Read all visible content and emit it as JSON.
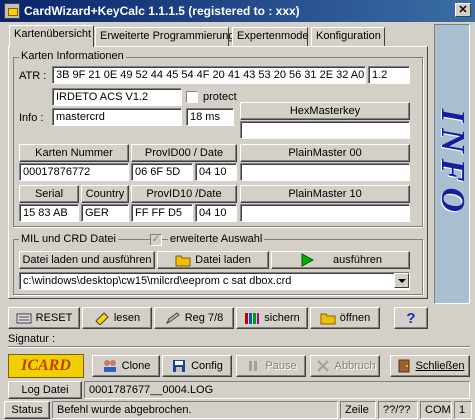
{
  "window": {
    "title": "CardWizard+KeyCalc 1.1.1.5 (registered to : xxx)",
    "close_glyph": "✕"
  },
  "tabs": [
    {
      "label": "Kartenübersicht",
      "active": true
    },
    {
      "label": "Erweiterte Programmierung"
    },
    {
      "label": "Expertenmode"
    },
    {
      "label": "Konfiguration"
    }
  ],
  "karten": {
    "legend": "Karten Informationen",
    "atr_label": "ATR :",
    "atr_value": "3B 9F 21 0E 49 52 44 45 54 4F 20 41 43 53 20 56 31 2E 32 A0",
    "atr_version": "1.2",
    "card_name": "IRDETO ACS V1.2",
    "protect_label": "protect",
    "info_label": "Info :",
    "info_value": "mastercrd",
    "info_time": "18 ms",
    "hexmasterkey_button": "HexMasterkey",
    "hexmasterkey_value": "",
    "kartennummer_button": "Karten Nummer",
    "kartennummer_value": "00017876772",
    "provid00_button": "ProvID00 / Date",
    "provid00_value": "06 6F 5D",
    "provid00_date": "04 10",
    "plainmaster00_button": "PlainMaster 00",
    "plainmaster00_value": "",
    "serial_button": "Serial",
    "serial_value": "15 83 AB",
    "country_button": "Country",
    "country_value": "GER",
    "provid10_button": "ProvID10 /Date",
    "provid10_value": "FF FF D5",
    "provid10_date": "04 10",
    "plainmaster10_button": "PlainMaster 10",
    "plainmaster10_value": ""
  },
  "mil": {
    "legend": "MIL und CRD Datei",
    "erweiterte_label": "erweiterte Auswahl",
    "checkmark": "✓",
    "load_execute_button": "Datei laden und ausführen",
    "load_button": "Datei laden",
    "execute_button": "ausführen",
    "file_path": "c:\\windows\\desktop\\cw15\\milcrd\\eeprom c sat dbox.crd"
  },
  "info_panel": {
    "text": "INFO"
  },
  "toolbar": {
    "reset": "RESET",
    "lesen": "lesen",
    "reg": "Reg 7/8",
    "sichern": "sichern",
    "oeffnen": "öffnen",
    "help": "?"
  },
  "signatur": {
    "label": "Signatur :",
    "value": ""
  },
  "actions": {
    "logo": "ICARD",
    "clone": "Clone",
    "config": "Config",
    "pause": "Pause",
    "abbruch": "Abbruch",
    "schliessen": "Schließen"
  },
  "logfile": {
    "label": "Log Datei",
    "value": "0001787677__0004.LOG"
  },
  "statusbar": {
    "label": "Status",
    "message": "Befehl wurde abgebrochen.",
    "zeile": "Zeile",
    "position": "??/??",
    "port": "COM",
    "port_num": "1"
  },
  "colors": {
    "title_start": "#0a246a",
    "title_end": "#3a6ea5",
    "info_bg": "#a8c0d0",
    "info_text": "#1a1aa0",
    "face": "#d4d0c8"
  }
}
